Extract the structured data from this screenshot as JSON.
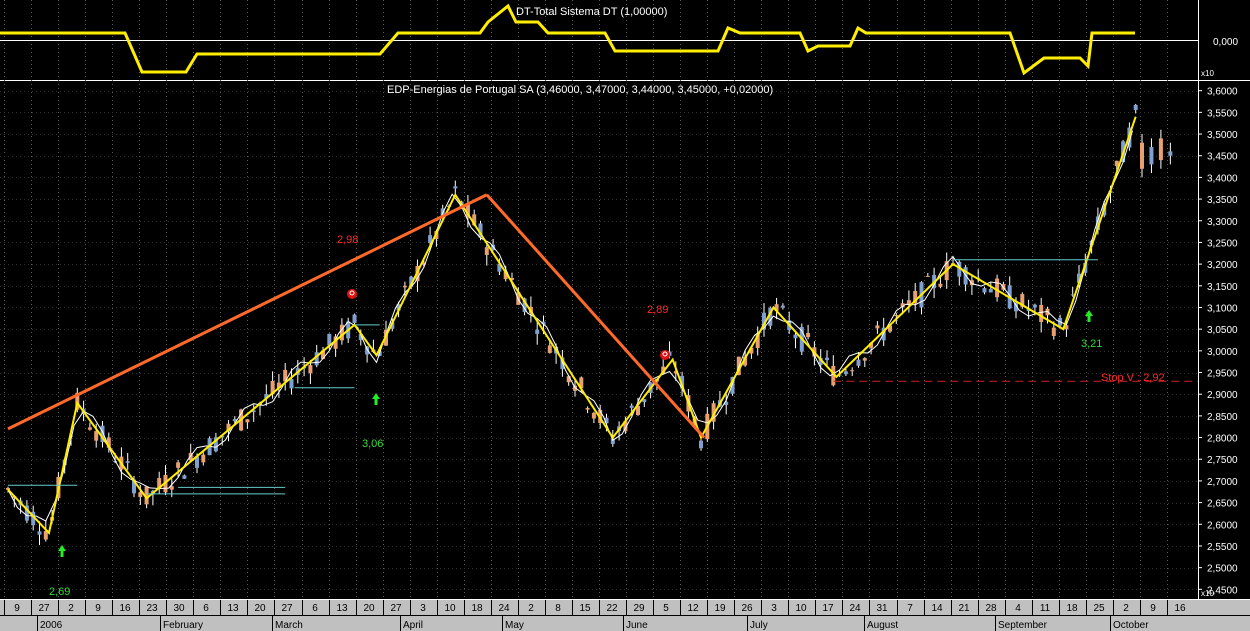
{
  "indicator": {
    "title": "DT-Total Sistema DT (1,00000)",
    "level_label": "0,000",
    "scale_label": "x10",
    "line_color": "#ffee00"
  },
  "chart_data": {
    "type": "candlestick",
    "title": "EDP-Energias de Portugal SA (3,46000, 3,47000, 3,44000, 3,45000, +0,02000)",
    "ylim": [
      2.43,
      3.62
    ],
    "y_ticks": [
      "3,6000",
      "3,5500",
      "3,5000",
      "3,4500",
      "3,4000",
      "3,3500",
      "3,3000",
      "3,2500",
      "3,2000",
      "3,1500",
      "3,1000",
      "3,0500",
      "3,0000",
      "2,9500",
      "2,9000",
      "2,8500",
      "2,8000",
      "2,7500",
      "2,7000",
      "2,6500",
      "2,6000",
      "2,5500",
      "2,5000",
      "2,4500"
    ],
    "y_scale_label": "x10",
    "x_day_labels": [
      "9",
      "27",
      "2",
      "9",
      "16",
      "23",
      "30",
      "6",
      "13",
      "20",
      "27",
      "6",
      "13",
      "20",
      "27",
      "3",
      "10",
      "18",
      "24",
      "2",
      "8",
      "15",
      "22",
      "29",
      "5",
      "12",
      "19",
      "26",
      "3",
      "10",
      "17",
      "24",
      "31",
      "7",
      "14",
      "21",
      "28",
      "4",
      "11",
      "18",
      "25",
      "2",
      "9",
      "16"
    ],
    "x_month_labels": [
      "2006",
      "February",
      "March",
      "April",
      "May",
      "June",
      "July",
      "August",
      "September",
      "October"
    ],
    "annotations": [
      {
        "text": "2,98",
        "color": "#ff2a2a"
      },
      {
        "text": "2,89",
        "color": "#ff2a2a"
      },
      {
        "text": "3,06",
        "color": "#33dd33"
      },
      {
        "text": "2,69",
        "color": "#33dd33"
      },
      {
        "text": "3,21",
        "color": "#33dd33"
      },
      {
        "text": "Stop V : 2,92",
        "color": "#ff2a2a"
      }
    ],
    "stop_level": 2.93,
    "zigzag": [
      {
        "day": 0,
        "value": 2.68
      },
      {
        "day": 13,
        "value": 2.58
      },
      {
        "day": 22,
        "value": 2.88
      },
      {
        "day": 44,
        "value": 2.66
      },
      {
        "day": 110,
        "value": 3.06
      },
      {
        "day": 117,
        "value": 2.99
      },
      {
        "day": 142,
        "value": 3.36
      },
      {
        "day": 192,
        "value": 2.8
      },
      {
        "day": 211,
        "value": 2.98
      },
      {
        "day": 220,
        "value": 2.8
      },
      {
        "day": 243,
        "value": 3.1
      },
      {
        "day": 263,
        "value": 2.94
      },
      {
        "day": 300,
        "value": 3.2
      },
      {
        "day": 335,
        "value": 3.05
      },
      {
        "day": 358,
        "value": 3.54
      }
    ],
    "trend_lines": [
      {
        "points": [
          {
            "day": 0,
            "value": 2.82
          },
          {
            "day": 152,
            "value": 3.36
          }
        ],
        "color": "#ff6a2a"
      },
      {
        "points": [
          {
            "day": 152,
            "value": 3.36
          },
          {
            "day": 221,
            "value": 2.8
          }
        ],
        "color": "#ff6a2a"
      }
    ],
    "up_color": "#e8a070",
    "down_color": "#7f9fd0",
    "wick_color": "#ffffff",
    "zigzag_color": "#ffee00"
  }
}
